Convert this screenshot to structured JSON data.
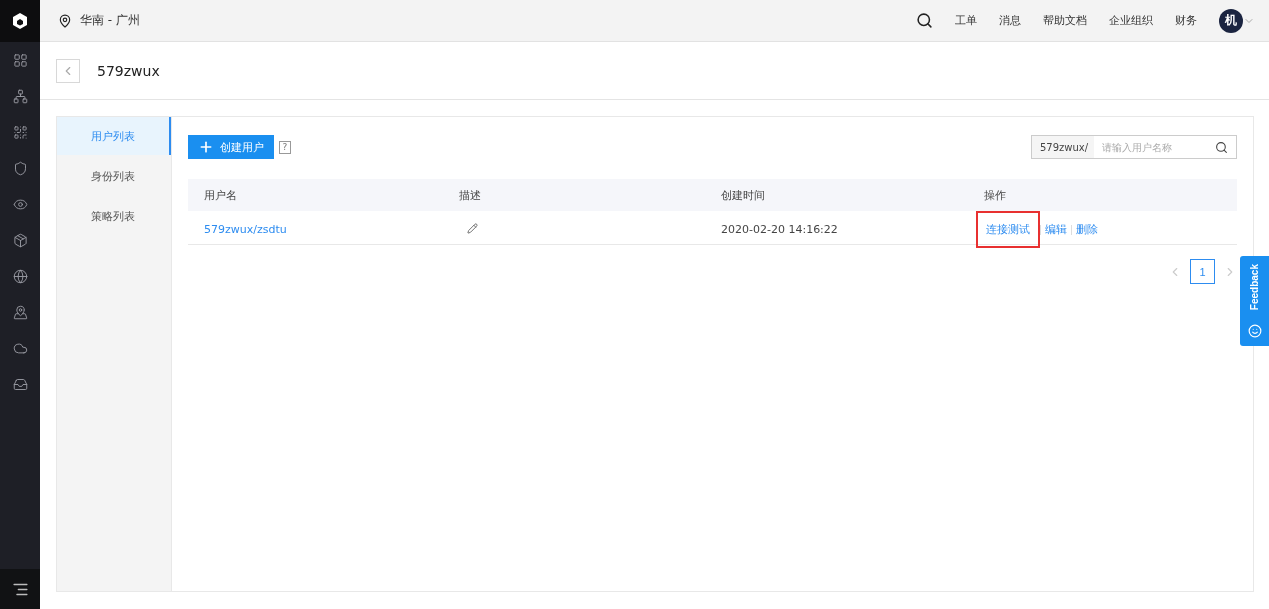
{
  "topbar": {
    "region": "华南 - 广州",
    "links": [
      "工单",
      "消息",
      "帮助文档",
      "企业组织",
      "财务"
    ],
    "avatar": "机"
  },
  "page": {
    "title": "579zwux"
  },
  "tabs": [
    {
      "label": "用户列表",
      "selected": true
    },
    {
      "label": "身份列表",
      "selected": false
    },
    {
      "label": "策略列表",
      "selected": false
    }
  ],
  "create_button": "创建用户",
  "help": "?",
  "search": {
    "prefix": "579zwux/",
    "placeholder": "请输入用户名称"
  },
  "table": {
    "columns": [
      "用户名",
      "描述",
      "创建时间",
      "操作"
    ],
    "rows": [
      {
        "name": "579zwux/zsdtu",
        "created": "2020-02-20 14:16:22",
        "actions": [
          {
            "label": "连接测试",
            "highlighted": true
          },
          {
            "label": "编辑",
            "highlighted": false
          },
          {
            "label": "删除",
            "highlighted": false
          }
        ]
      }
    ]
  },
  "pagination": {
    "pages": [
      {
        "label": "1",
        "selected": true
      }
    ]
  },
  "feedback": "Feedback"
}
